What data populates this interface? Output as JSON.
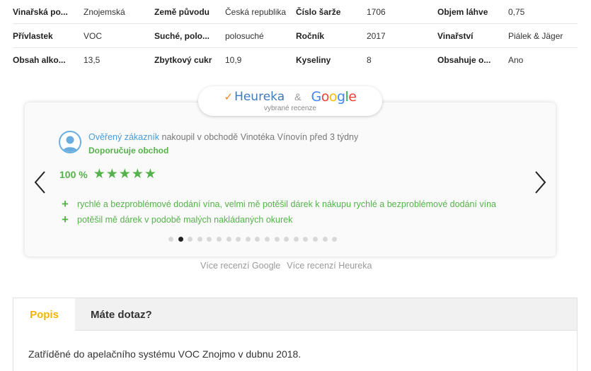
{
  "specs": [
    [
      {
        "label": "Vinařská po...",
        "value": "Znojemská"
      },
      {
        "label": "Země původu",
        "value": "Česká republika"
      },
      {
        "label": "Číslo šarže",
        "value": "1706"
      },
      {
        "label": "Objem láhve",
        "value": "0,75"
      }
    ],
    [
      {
        "label": "Přívlastek",
        "value": "VOC"
      },
      {
        "label": "Suché, polo...",
        "value": "polosuché"
      },
      {
        "label": "Ročník",
        "value": "2017"
      },
      {
        "label": "Vinařství",
        "value": "Piálek & Jäger"
      }
    ],
    [
      {
        "label": "Obsah alko...",
        "value": "13,5"
      },
      {
        "label": "Zbytkový cukr",
        "value": "10,9"
      },
      {
        "label": "Kyseliny",
        "value": "8"
      },
      {
        "label": "Obsahuje o...",
        "value": "Ano"
      }
    ]
  ],
  "badge": {
    "heureka": "Heureka",
    "amp": "&",
    "google": [
      "G",
      "o",
      "o",
      "g",
      "l",
      "e"
    ],
    "subtitle": "vybrané recenze"
  },
  "review": {
    "verified": "Ověřený zákazník",
    "bought": " nakoupil v obchodě Vinotéka Vínovín před 3 týdny",
    "recommend": "Doporučuje obchod",
    "percent": "100 %",
    "stars": "★★★★★",
    "pros": [
      "rychlé a bezproblémové dodání vína, velmi mě potěšil dárek k nákupu rychlé a bezproblémové dodání vína",
      "potěšil mě dárek v podobě malých nakládaných okurek"
    ]
  },
  "carousel": {
    "total_dots": 18,
    "active_dot": 2
  },
  "links": {
    "google": "Více recenzí Google",
    "heureka": "Více recenzí Heureka"
  },
  "tabs": {
    "popis": "Popis",
    "dotaz": "Máte dotaz?"
  },
  "description": "Zatříděné do apelačního systému VOC Znojmo v dubnu 2018.",
  "colors": {
    "accent_green": "#55b24a",
    "link_blue": "#4a9bd6",
    "tab_yellow": "#f2b600",
    "heureka_orange": "#f08a24"
  }
}
